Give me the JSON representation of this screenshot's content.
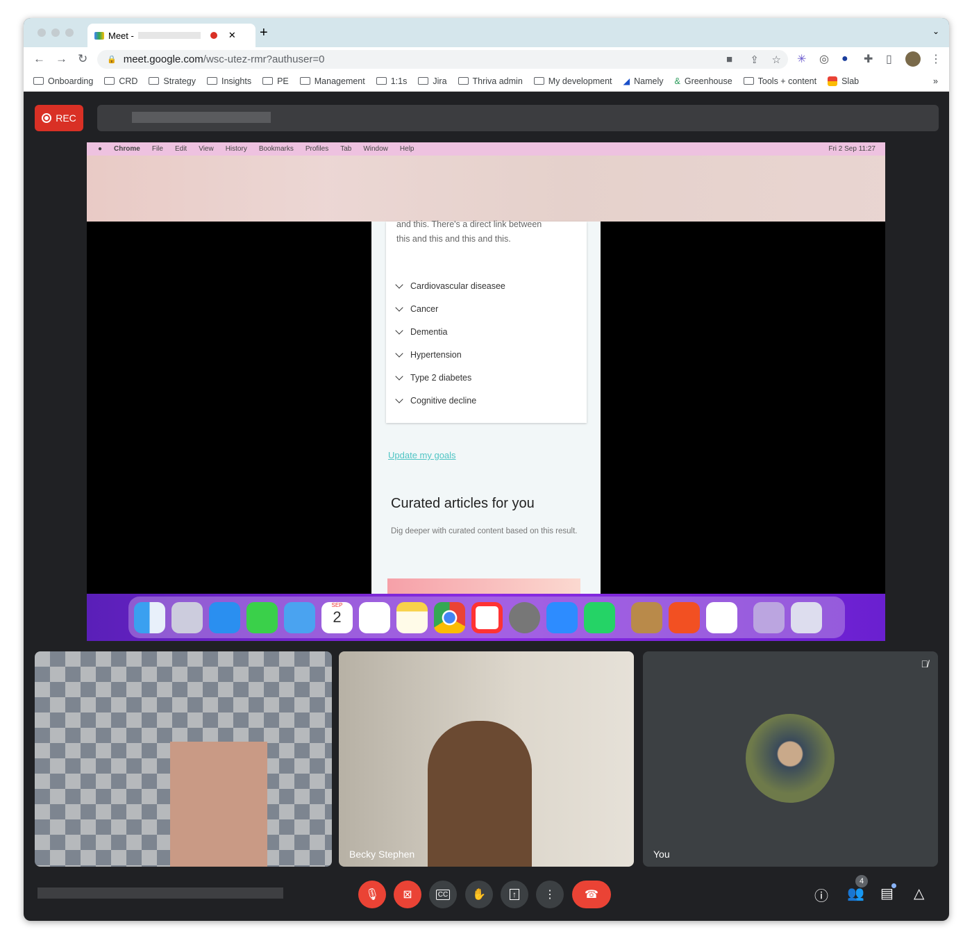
{
  "browser": {
    "tab_title": "Meet -",
    "url_host": "meet.google.com",
    "url_path": "/wsc-utez-rmr?authuser=0",
    "bookmarks": [
      "Onboarding",
      "CRD",
      "Strategy",
      "Insights",
      "PE",
      "Management",
      "1:1s",
      "Jira",
      "Thriva admin",
      "My development",
      "Namely",
      "Greenhouse",
      "Tools + content",
      "Slab"
    ]
  },
  "meet": {
    "rec_label": "REC",
    "mac_menu": [
      "Chrome",
      "File",
      "Edit",
      "View",
      "History",
      "Bookmarks",
      "Profiles",
      "Tab",
      "Window",
      "Help"
    ],
    "mac_clock": "Fri 2 Sep  11:27",
    "shared_page": {
      "intro_line1": "and this. There's a direct link between",
      "intro_line2": "this and this and this and this.",
      "conditions": [
        "Cardiovascular diseasee",
        "Cancer",
        "Dementia",
        "Hypertension",
        "Type 2 diabetes",
        "Cognitive decline"
      ],
      "update_link": "Update my goals",
      "section_title": "Curated articles for you",
      "section_desc": "Dig deeper with curated content based on this result."
    },
    "dock_calendar": {
      "month": "SEP",
      "day": "2"
    },
    "participants": [
      {
        "name": ""
      },
      {
        "name": "Becky Stephen"
      },
      {
        "name": "You"
      }
    ],
    "participant_count": "4",
    "colors": {
      "red": "#ea4335",
      "dark": "#202124",
      "button": "#3c4043"
    }
  }
}
